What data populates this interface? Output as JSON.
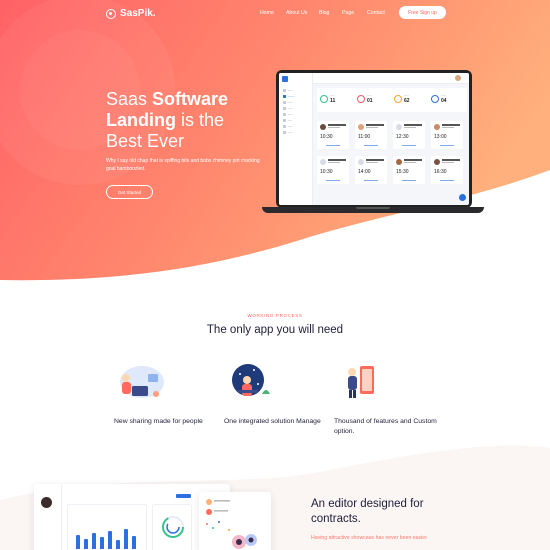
{
  "nav": {
    "logo": "SasPik.",
    "links": [
      "Home",
      "About Us",
      "Blog",
      "Page",
      "Contact"
    ],
    "signup": "Free Sign up"
  },
  "hero": {
    "title_part1": "Saas ",
    "title_bold1": "Software",
    "title_bold2": "Landing",
    "title_part2": " is the",
    "title_part3": "Best Ever",
    "subtitle": "Why I say old chap that is spiffing bits and bobs chimney pot cracking goal bamboozled.",
    "cta": "Get Started"
  },
  "dashboard": {
    "stats": [
      {
        "value": "11"
      },
      {
        "value": "01"
      },
      {
        "value": "62"
      },
      {
        "value": "04"
      }
    ],
    "times": [
      "10:30",
      "11:00",
      "12:30",
      "13:00",
      "10:30",
      "14:00",
      "15:30",
      "16:30"
    ],
    "colors": {
      "primary": "#2c6fe0",
      "green": "#34c38f",
      "red": "#f0596a",
      "orange": "#f7a23b"
    }
  },
  "working_process": {
    "label": "WORKING PROCESS",
    "title": "The only app you will need",
    "features": [
      {
        "text": "New sharing made for people"
      },
      {
        "text": "One integrated solution Manage"
      },
      {
        "text": "Thousand of features and Custom option."
      }
    ]
  },
  "editor": {
    "title": "An editor designed for contracts.",
    "subtitle": "Having attractive showcase has never been easier"
  },
  "theme": {
    "accent": "#ff6a5c",
    "gradient_start": "#ff5f6d",
    "gradient_end": "#ffb17a"
  }
}
